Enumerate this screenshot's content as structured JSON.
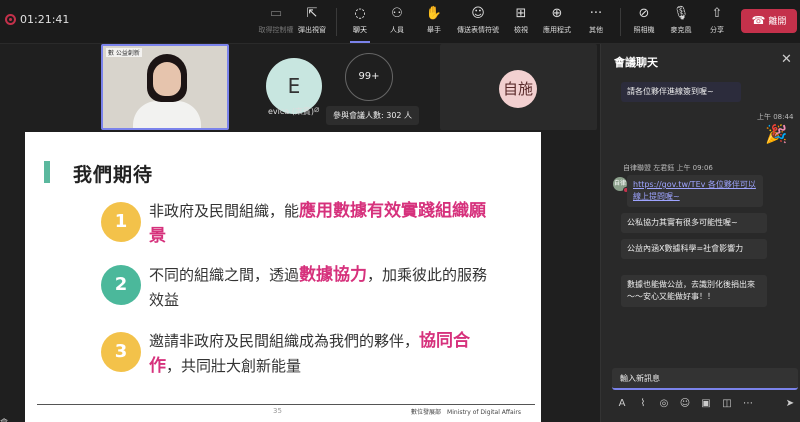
{
  "meeting": {
    "timer": "01:21:41"
  },
  "toolbar": {
    "give_control": "取得控制權",
    "popout": "彈出視窗",
    "chat": "聊天",
    "people": "人員",
    "raise_hand": "舉手",
    "react": "傳送表情符號",
    "view": "檢視",
    "apps": "應用程式",
    "more": "其他",
    "camera": "照相機",
    "mic": "麥克風",
    "share": "分享",
    "leave": "離開"
  },
  "stage": {
    "presenter_logo": "數 公益創新",
    "participant_e": {
      "initial": "E",
      "name": "evica (來賓)"
    },
    "overflow_count": "99+",
    "participants_tooltip": "參與會議人數: 302 人",
    "participant_zi": {
      "initial": "自施"
    },
    "corner_label": "會"
  },
  "slide": {
    "title": "我們期待",
    "items": [
      {
        "number": "1",
        "text_before": "非政府及民間組織，能",
        "highlight": "應用數據有效實踐組織願景",
        "text_after": ""
      },
      {
        "number": "2",
        "text_before": "不同的組織之間，透過",
        "highlight": "數據協力",
        "text_after": "，加乘彼此的服務效益"
      },
      {
        "number": "3",
        "text_before": "邀請非政府及民間組織成為我們的夥伴，",
        "highlight": "協同合作",
        "text_after": "，共同壯大創新能量"
      }
    ],
    "page_number": "35",
    "footer_org": "數位發展部",
    "footer_org_en": "Ministry of Digital Affairs",
    "colors": {
      "item1": "#f3c24a",
      "item2": "#4bb89b",
      "item3": "#f3c24a",
      "highlight": "#d6317c",
      "accent": "#5bb89e"
    }
  },
  "chat": {
    "title": "會議聊天",
    "messages": [
      {
        "text": "請各位夥伴進線簽到喔~"
      },
      {
        "time": "上午 08:44",
        "emoji": "party-popper-icon"
      },
      {
        "meta": "自律聯盟 左君鈺  上午 09:06",
        "avatar": "自律",
        "link": "https://gov.tw/TEv",
        "text": " 各位夥伴可以線上提問喔~"
      },
      {
        "text": "公私協力其實有很多可能性喔~"
      },
      {
        "text": "公益內涵X數據科學=社會影響力"
      },
      {
        "text": "數據也能做公益，去識別化後捐出來～～安心又能做好事！！"
      }
    ],
    "compose_placeholder": "輸入新訊息"
  }
}
